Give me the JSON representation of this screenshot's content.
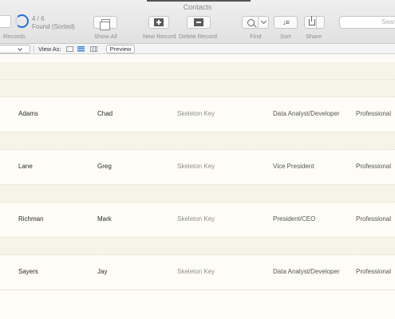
{
  "window": {
    "title": "Contacts"
  },
  "toolbar": {
    "records_label": "Records",
    "found_count": "4 / 6",
    "found_state": "Found (Sorted)",
    "show_all": "Show All",
    "new_record": "New Record",
    "delete_record": "Delete Record",
    "find": "Find",
    "sort": "Sort",
    "share": "Share",
    "search_placeholder": "Search",
    "sort_icon": "↓≡"
  },
  "layout_bar": {
    "view_as": "View As:",
    "preview": "Preview"
  },
  "records": [
    {
      "last": "Adams",
      "first": "Chad",
      "company": "Skeleton Key",
      "title": "Data Analyst/Developer",
      "category": "Professional"
    },
    {
      "last": "Lane",
      "first": "Greg",
      "company": "Skeleton Key",
      "title": "Vice President",
      "category": "Professional"
    },
    {
      "last": "Richman",
      "first": "Mark",
      "company": "Skeleton Key",
      "title": "President/CEO",
      "category": "Professional"
    },
    {
      "last": "Sayers",
      "first": "Jay",
      "company": "Skeleton Key",
      "title": "Data Analyst/Developer",
      "category": "Professional"
    }
  ],
  "colors": {
    "accent": "#1e73d6",
    "band": "#f6f3e8",
    "background": "#fdfcf6"
  }
}
